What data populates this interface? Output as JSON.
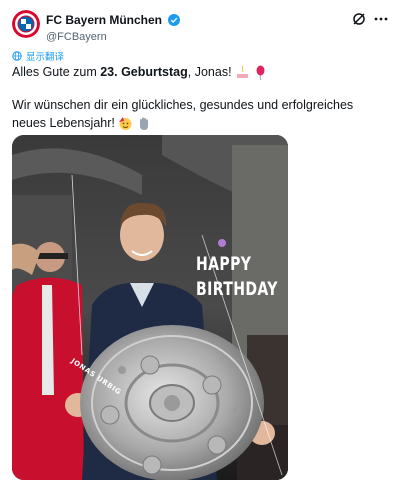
{
  "account": {
    "display_name": "FC Bayern München",
    "handle": "@FCBayern",
    "avatar": "fc-bayern-logo-icon",
    "verified": "verified-badge-icon"
  },
  "actions": {
    "grok": "grok-icon",
    "more": "more-icon"
  },
  "translate": {
    "label": "显示翻译",
    "icon": "translate-globe-icon"
  },
  "post": {
    "line1_prefix": "Alles Gute zum ",
    "line1_bold": "23. Geburtstag",
    "line1_suffix": ", Jonas!",
    "line1_emojis": [
      "birthday-cake-emoji",
      "balloon-emoji"
    ],
    "line2_text": "Wir wünschen dir ein glückliches, gesundes und erfolgreiches neues Lebensjahr!",
    "line2_emojis": [
      "party-face-emoji",
      "hand-emoji"
    ]
  },
  "image": {
    "happy": "HAPPY",
    "birthday": "BIRTHDAY",
    "name_tag": "JONAS URBIG",
    "subject": "player-holding-meisterschale-trophy"
  },
  "colors": {
    "link": "#1d9bf0",
    "text": "#0f1419",
    "secondary": "#536471",
    "bayern_red": "#dc052d",
    "bayern_blue": "#0066b2"
  }
}
